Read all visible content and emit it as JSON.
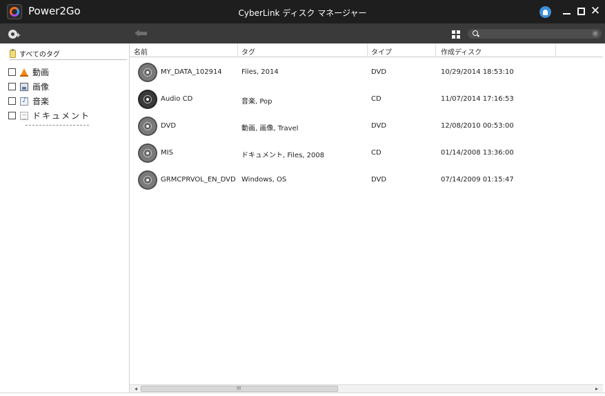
{
  "titlebar": {
    "app_name": "Power2Go",
    "window_title": "CyberLink ディスク マネージャー",
    "minimize_label": "",
    "close_label": "✕"
  },
  "toolbar": {
    "search": {
      "value": "",
      "placeholder": ""
    }
  },
  "sidebar": {
    "all_tags_label": "すべてのタグ",
    "tags": [
      {
        "label": "動画",
        "icon": "video-icon",
        "checked": false
      },
      {
        "label": "画像",
        "icon": "image-icon",
        "checked": false
      },
      {
        "label": "音楽",
        "icon": "music-icon",
        "checked": false
      },
      {
        "label": "ドキュメント",
        "icon": "document-icon",
        "checked": false
      }
    ]
  },
  "table": {
    "columns": [
      "名前",
      "タグ",
      "タイプ",
      "作成ディスク"
    ],
    "rows": [
      {
        "name": "MY_DATA_102914",
        "tags": "Files, 2014",
        "type": "DVD",
        "created": "10/29/2014 18:53:10",
        "icon": "disc-icon"
      },
      {
        "name": "Audio CD",
        "tags": "音楽, Pop",
        "type": "CD",
        "created": "11/07/2014 17:16:53",
        "icon": "audio-disc-icon"
      },
      {
        "name": "DVD",
        "tags": "動画, 画像, Travel",
        "type": "DVD",
        "created": "12/08/2010 00:53:00",
        "icon": "disc-icon"
      },
      {
        "name": "MIS",
        "tags": "ドキュメント, Files, 2008",
        "type": "CD",
        "created": "01/14/2008 13:36:00",
        "icon": "disc-icon"
      },
      {
        "name": "GRMCPRVOL_EN_DVD",
        "tags": "Windows, OS",
        "type": "DVD",
        "created": "07/14/2009 01:15:47",
        "icon": "disc-icon"
      }
    ]
  },
  "scrollbar": {
    "left_arrow": "◂",
    "right_arrow": "▸",
    "grip": "III"
  },
  "colors": {
    "titlebar_bg": "#1e1e1e",
    "toolbar_bg": "#3a3a3a",
    "notification_blue": "#3d8fd8"
  }
}
